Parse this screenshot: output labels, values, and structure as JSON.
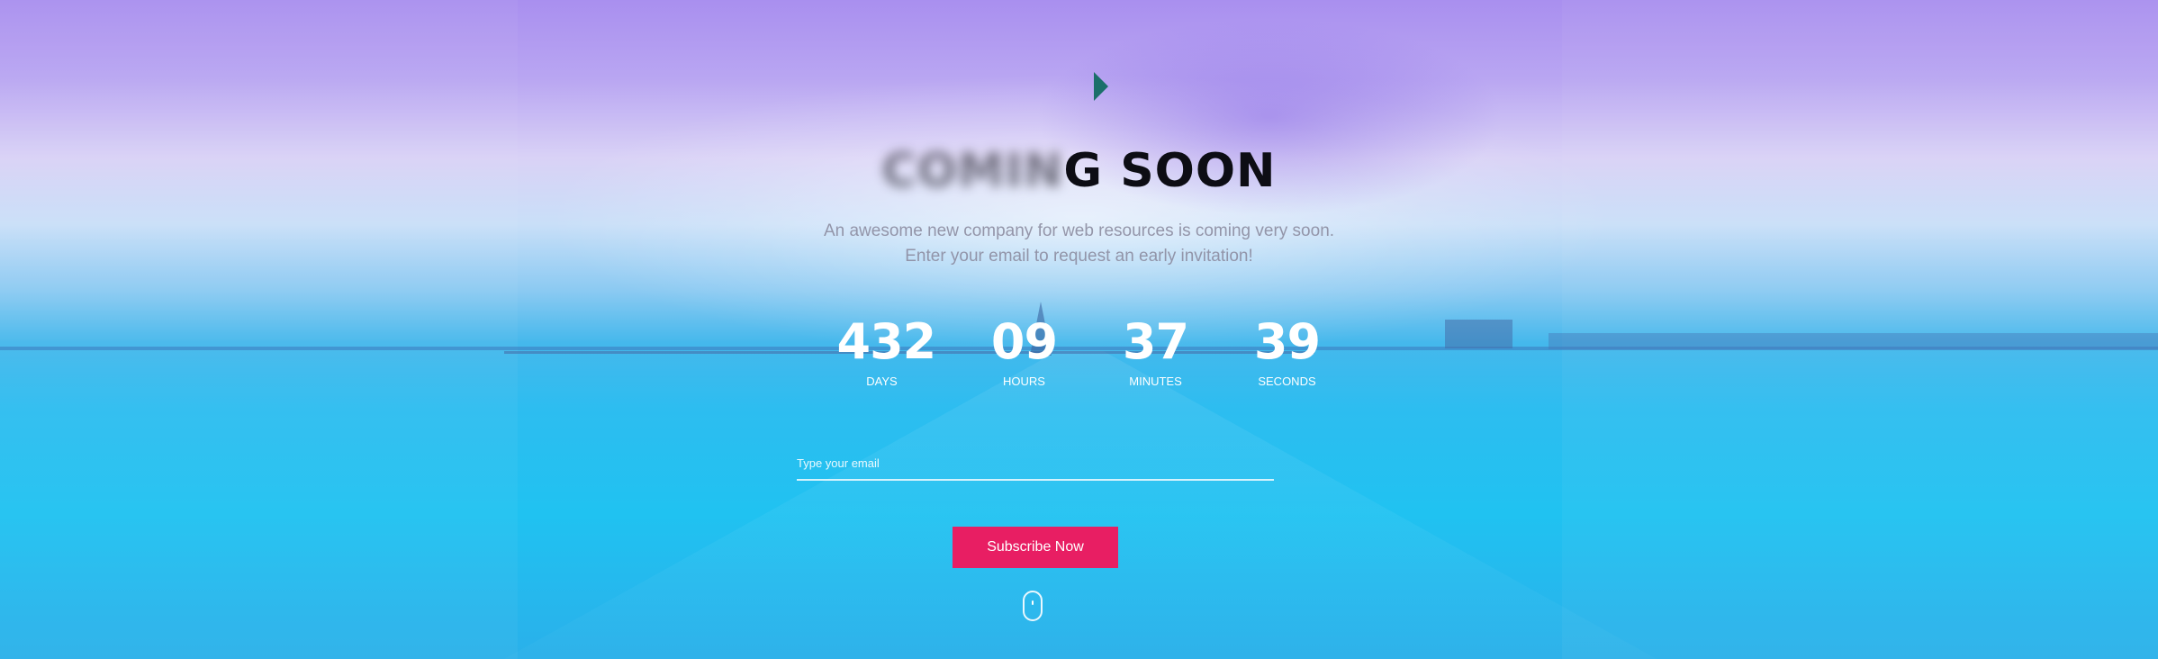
{
  "hero": {
    "title_blurred": "COMIN",
    "title_visible": "G SOON",
    "subtitle_line1": "An awesome new company for web resources is coming very soon.",
    "subtitle_line2": "Enter your email to request an early invitation!"
  },
  "countdown": [
    {
      "value": "432",
      "label": "DAYS"
    },
    {
      "value": "09",
      "label": "HOURS"
    },
    {
      "value": "37",
      "label": "MINUTES"
    },
    {
      "value": "39",
      "label": "SECONDS"
    }
  ],
  "form": {
    "email_placeholder": "Type your email",
    "subscribe_label": "Subscribe Now"
  },
  "icons": {
    "logo": "play-triangle-logo",
    "scroll": "mouse-scroll-icon"
  },
  "colors": {
    "accent": "#e81e63",
    "logo": "#1b6f6a"
  }
}
